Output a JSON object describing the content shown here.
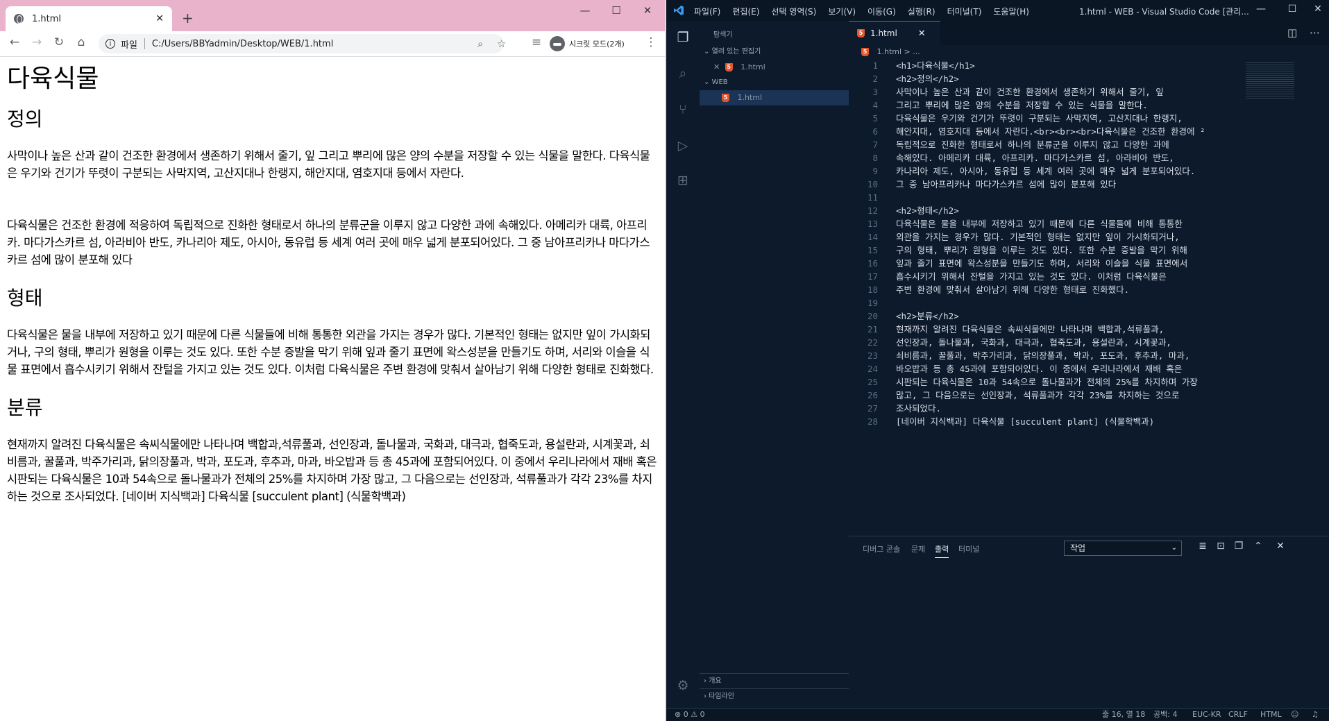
{
  "browser": {
    "tab_title": "1.html",
    "new_tab": "+",
    "scheme": "파일",
    "url": "C:/Users/BBYadmin/Desktop/WEB/1.html",
    "incognito": "시크릿 모드(2개)",
    "titlebar_color": "#e9b4cb",
    "page": {
      "h1": "다육식물",
      "sections": [
        {
          "heading": "정의",
          "paragraphs": [
            "사막이나 높은 산과 같이 건조한 환경에서 생존하기 위해서 줄기, 잎 그리고 뿌리에 많은 양의 수분을 저장할 수 있는 식물을 말한다. 다육식물은 우기와 건기가 뚜렷이 구분되는 사막지역, 고산지대나 한랭지, 해안지대, 염호지대 등에서 자란다.",
            "다육식물은 건조한 환경에 적응하여 독립적으로 진화한 형태로서 하나의 분류군을 이루지 않고 다양한 과에 속해있다. 아메리카 대륙, 아프리카. 마다가스카르 섬, 아라비아 반도, 카나리아 제도, 아시아, 동유럽 등 세계 여러 곳에 매우 넓게 분포되어있다. 그 중 남아프리카나 마다가스카르 섬에 많이 분포해 있다"
          ]
        },
        {
          "heading": "형태",
          "paragraphs": [
            "다육식물은 물을 내부에 저장하고 있기 때문에 다른 식물들에 비해 통통한 외관을 가지는 경우가 많다. 기본적인 형태는 없지만 잎이 가시화되거나, 구의 형태, 뿌리가 원형을 이루는 것도 있다. 또한 수분 증발을 막기 위해 잎과 줄기 표면에 왁스성분을 만들기도 하며, 서리와 이슬을 식물 표면에서 흡수시키기 위해서 잔털을 가지고 있는 것도 있다. 이처럼 다육식물은 주변 환경에 맞춰서 살아남기 위해 다양한 형태로 진화했다."
          ]
        },
        {
          "heading": "분류",
          "paragraphs": [
            "현재까지 알려진 다육식물은 속씨식물에만 나타나며 백합과,석류풀과, 선인장과, 돌나물과, 국화과, 대극과, 협죽도과, 용설란과, 시계꽃과, 쇠비름과, 꿀풀과, 박주가리과, 닭의장풀과, 박과, 포도과, 후추과, 마과, 바오밥과 등 총 45과에 포함되어있다. 이 중에서 우리나라에서 재배 혹은 시판되는 다육식물은 10과 54속으로 돌나물과가 전체의 25%를 차지하며 가장 많고, 그 다음으로는 선인장과, 석류풀과가 각각 23%를 차지하는 것으로 조사되었다. [네이버 지식백과] 다육식물 [succulent plant] (식물학백과)"
          ]
        }
      ]
    }
  },
  "vscode": {
    "menu": [
      "파일(F)",
      "편집(E)",
      "선택 영역(S)",
      "보기(V)",
      "이동(G)",
      "실행(R)",
      "터미널(T)",
      "도움말(H)"
    ],
    "window_title": "1.html - WEB - Visual Studio Code [관리...",
    "sidebar": {
      "header": "탐색기",
      "open_editors": "열려 있는 편집기",
      "open_file": "1.html",
      "folder": "WEB",
      "folder_file": "1.html",
      "outline": "개요",
      "timeline": "타임라인"
    },
    "tab_title": "1.html",
    "breadcrumb": "1.html > ...",
    "code_lines": [
      {
        "n": "1",
        "t": "<h1>다육식물</h1>"
      },
      {
        "n": "2",
        "t": "<h2>정의</h2>"
      },
      {
        "n": "3",
        "t": "사막이나 높은 산과 같이 건조한 환경에서 생존하기 위해서 줄기, 잎"
      },
      {
        "n": "4",
        "t": "그리고 뿌리에 많은 양의 수분을 저장할 수 있는 식물을 말한다."
      },
      {
        "n": "5",
        "t": "다육식물은 우기와 건기가 뚜렷이 구분되는 사막지역, 고산지대나 한랭지,"
      },
      {
        "n": "6",
        "t": "해안지대, 염호지대 등에서 자란다.<br><br><br>다육식물은 건조한 환경에 ²"
      },
      {
        "n": "7",
        "t": "독립적으로 진화한 형태로서 하나의 분류군을 이루지 않고 다양한 과에"
      },
      {
        "n": "8",
        "t": "속해있다. 아메리카 대륙, 아프리카. 마다가스카르 섬, 아라비아 반도,"
      },
      {
        "n": "9",
        "t": "카나리아 제도, 아시아, 동유럽 등 세계 여러 곳에 매우 넓게 분포되어있다."
      },
      {
        "n": "10",
        "t": "그 중 남아프리카나 마다가스카르 섬에 많이 분포해 있다"
      },
      {
        "n": "11",
        "t": ""
      },
      {
        "n": "12",
        "t": "<h2>형태</h2>"
      },
      {
        "n": "13",
        "t": "다육식물은 물을 내부에 저장하고 있기 때문에 다른 식물들에 비해 통통한"
      },
      {
        "n": "14",
        "t": "외관을 가지는 경우가 많다. 기본적인 형태는 없지만 잎이 가시화되거나,"
      },
      {
        "n": "15",
        "t": "구의 형태, 뿌리가 원형을 이루는 것도 있다. 또한 수분 증발을 막기 위해"
      },
      {
        "n": "16",
        "t": "잎과 줄기 표면에 왁스성분을 만들기도 하며, 서리와 이슬을 식물 표면에서"
      },
      {
        "n": "17",
        "t": "흡수시키기 위해서 잔털을 가지고 있는 것도 있다. 이처럼 다육식물은"
      },
      {
        "n": "18",
        "t": "주변 환경에 맞춰서 살아남기 위해 다양한 형태로 진화했다."
      },
      {
        "n": "19",
        "t": ""
      },
      {
        "n": "20",
        "t": "<h2>분류</h2>"
      },
      {
        "n": "21",
        "t": "현재까지 알려진 다육식물은 속씨식물에만 나타나며 백합과,석류풀과,"
      },
      {
        "n": "22",
        "t": "선인장과, 돌나물과, 국화과, 대극과, 협죽도과, 용설란과, 시계꽃과,"
      },
      {
        "n": "23",
        "t": "쇠비름과, 꿀풀과, 박주가리과, 닭의장풀과, 박과, 포도과, 후추과, 마과,"
      },
      {
        "n": "24",
        "t": "바오밥과 등 총 45과에 포함되어있다. 이 중에서 우리나라에서 재배 혹은"
      },
      {
        "n": "25",
        "t": "시판되는 다육식물은 10과 54속으로 돌나물과가 전체의 25%를 차지하며 가장"
      },
      {
        "n": "26",
        "t": "많고, 그 다음으로는 선인장과, 석류풀과가 각각 23%를 차지하는 것으로"
      },
      {
        "n": "27",
        "t": "조사되었다."
      },
      {
        "n": "28",
        "t": "[네이버 지식백과] 다육식물 [succulent plant] (식물학백과)"
      }
    ],
    "panel": {
      "tabs": [
        "디버그 콘솔",
        "문제",
        "출력",
        "터미널"
      ],
      "active_tab": "출력",
      "select_value": "작업"
    },
    "status": {
      "problems": "⊗ 0 ⚠ 0",
      "position": "줄 16, 열 18",
      "spaces": "공백: 4",
      "encoding": "EUC-KR",
      "eol": "CRLF",
      "language": "HTML"
    }
  }
}
